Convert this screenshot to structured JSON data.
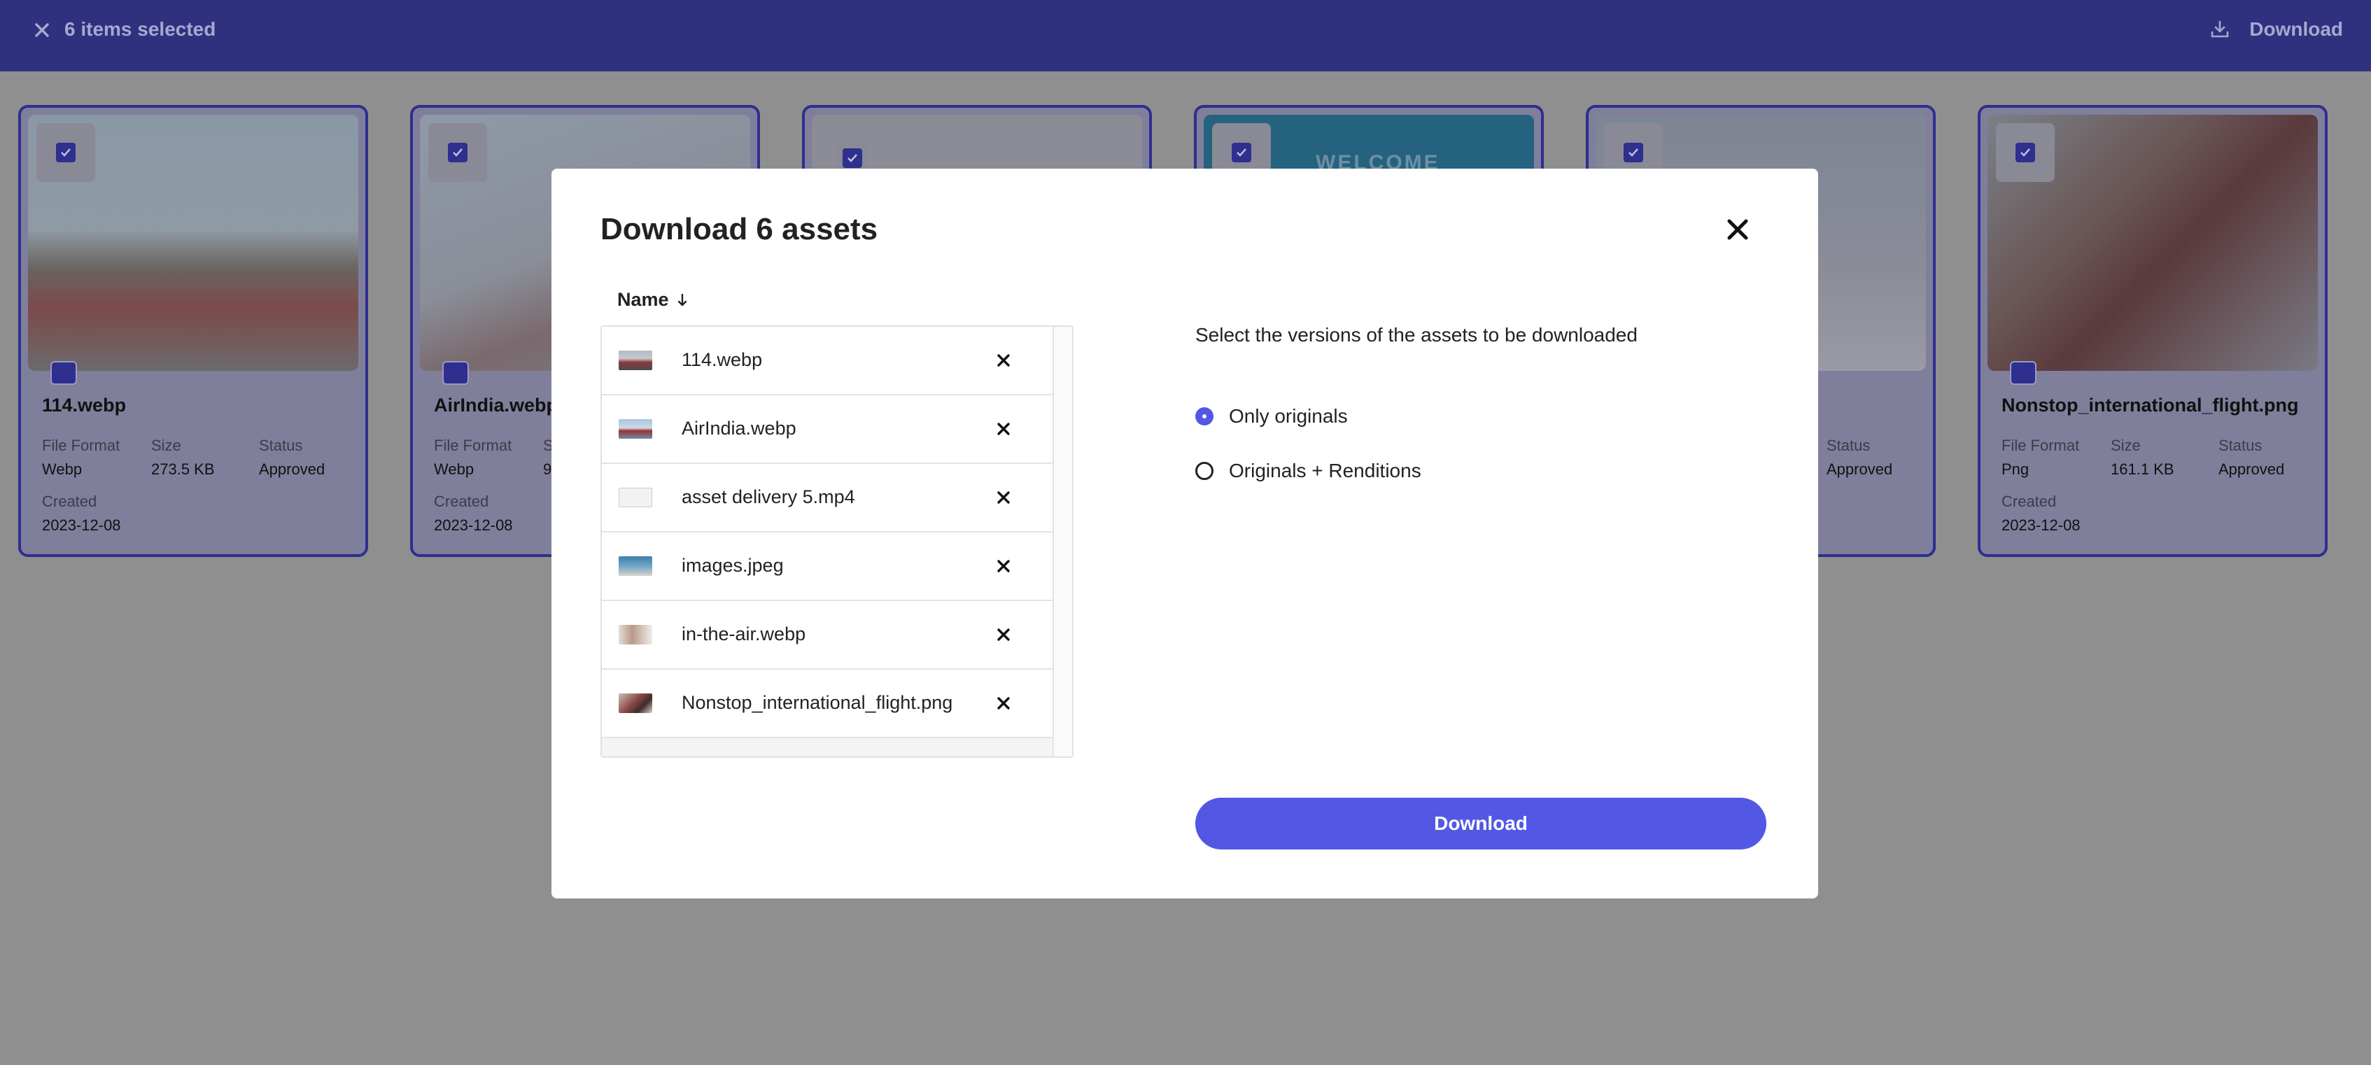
{
  "topbar": {
    "selected_label": "6 items selected",
    "download_label": "Download"
  },
  "cards": [
    {
      "title": "114.webp",
      "format_label": "File Format",
      "format": "Webp",
      "size_label": "Size",
      "size": "273.5 KB",
      "status_label": "Status",
      "status": "Approved",
      "created_label": "Created",
      "created": "2023-12-08"
    },
    {
      "title": "AirIndia.webp",
      "format_label": "File Format",
      "format": "Webp",
      "size_label": "S",
      "size": "9",
      "created_label": "Created",
      "created": "2023-12-08"
    },
    {
      "title": "",
      "note": "asset delivery 5.mp4 (card mostly hidden)"
    },
    {
      "title": "",
      "banner": "WELCOME"
    },
    {
      "title": "",
      "status_label": "Status",
      "status": "Approved"
    },
    {
      "title": "Nonstop_international_flight.png",
      "format_label": "File Format",
      "format": "Png",
      "size_label": "Size",
      "size": "161.1 KB",
      "status_label": "Status",
      "status": "Approved",
      "created_label": "Created",
      "created": "2023-12-08"
    }
  ],
  "modal": {
    "title": "Download 6 assets",
    "column_header": "Name",
    "files": [
      {
        "name": "114.webp"
      },
      {
        "name": "AirIndia.webp"
      },
      {
        "name": "asset delivery 5.mp4"
      },
      {
        "name": "images.jpeg"
      },
      {
        "name": "in-the-air.webp"
      },
      {
        "name": "Nonstop_international_flight.png"
      }
    ],
    "instruction": "Select the versions of the assets to be downloaded",
    "options": [
      {
        "label": "Only originals",
        "selected": true
      },
      {
        "label": "Originals + Renditions",
        "selected": false
      }
    ],
    "download_button": "Download"
  },
  "colors": {
    "topbar": "#2f307e",
    "accent": "#5258e4",
    "overlay": "#8f8f8f"
  }
}
